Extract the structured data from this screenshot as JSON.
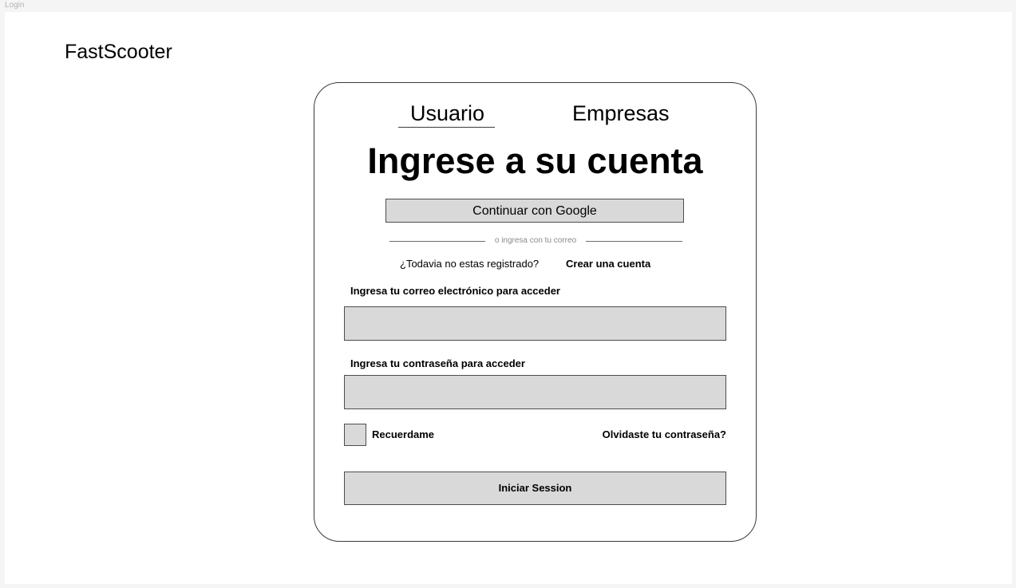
{
  "frame": {
    "label": "Login"
  },
  "brand": {
    "name": "FastScooter"
  },
  "tabs": [
    {
      "label": "Usuario",
      "active": true
    },
    {
      "label": "Empresas",
      "active": false
    }
  ],
  "login": {
    "heading": "Ingrese a su cuenta",
    "google_button": "Continuar con Google",
    "divider_text": "o ingresa con tu correo",
    "register_question": "¿Todavia no estas registrado?",
    "register_link": "Crear una cuenta",
    "email_label": "Ingresa tu correo electrónico para acceder",
    "email_value": "",
    "password_label": "Ingresa tu contraseña para acceder",
    "password_value": "",
    "remember_label": "Recuerdame",
    "remember_checked": false,
    "forgot_link": "Olvidaste tu contraseña?",
    "submit_button": "Iniciar Session"
  },
  "colors": {
    "page_background": "#f5f5f5",
    "frame_background": "#ffffff",
    "control_fill": "#d9d9d9",
    "control_border": "#4d4d4d",
    "muted_text": "#8a8a8a"
  }
}
